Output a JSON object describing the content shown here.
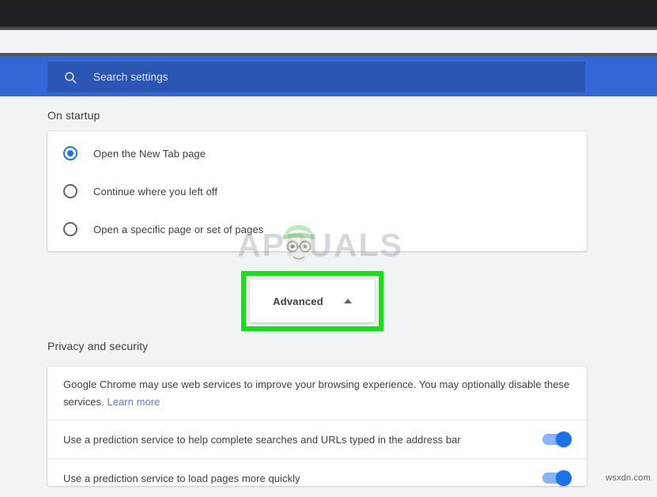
{
  "browser": {
    "title_bar": "",
    "toolbar": ""
  },
  "search": {
    "icon": "search-icon",
    "placeholder": "Search settings",
    "value": ""
  },
  "sections": {
    "on_startup": {
      "title": "On startup",
      "options": [
        {
          "label": "Open the New Tab page",
          "selected": true
        },
        {
          "label": "Continue where you left off",
          "selected": false
        },
        {
          "label": "Open a specific page or set of pages",
          "selected": false
        }
      ]
    },
    "privacy": {
      "title": "Privacy and security",
      "intro_text": "Google Chrome may use web services to improve your browsing experience. You may optionally disable these services.",
      "intro_link": "Learn more",
      "toggles": [
        {
          "label": "Use a prediction service to help complete searches and URLs typed in the address bar",
          "on": true
        },
        {
          "label": "Use a prediction service to load pages more quickly",
          "on": true
        }
      ]
    }
  },
  "advanced": {
    "label": "Advanced",
    "chevron": "chevron-up-icon",
    "expanded": true,
    "highlight_color": "#16e016"
  },
  "watermark": {
    "text": "APPUALS",
    "mascot": "mascot-icon"
  },
  "credit": "wsxdn.com",
  "colors": {
    "title_bar": "#202124",
    "settings_header": "#3367d6",
    "search_box": "#2b56b4",
    "page_background": "#f1f3f4",
    "card": "#ffffff",
    "accent_blue": "#1a73e8",
    "toggle_track": "#8ab4f8",
    "link": "#5f7fd4",
    "text_primary": "#3c4043"
  }
}
